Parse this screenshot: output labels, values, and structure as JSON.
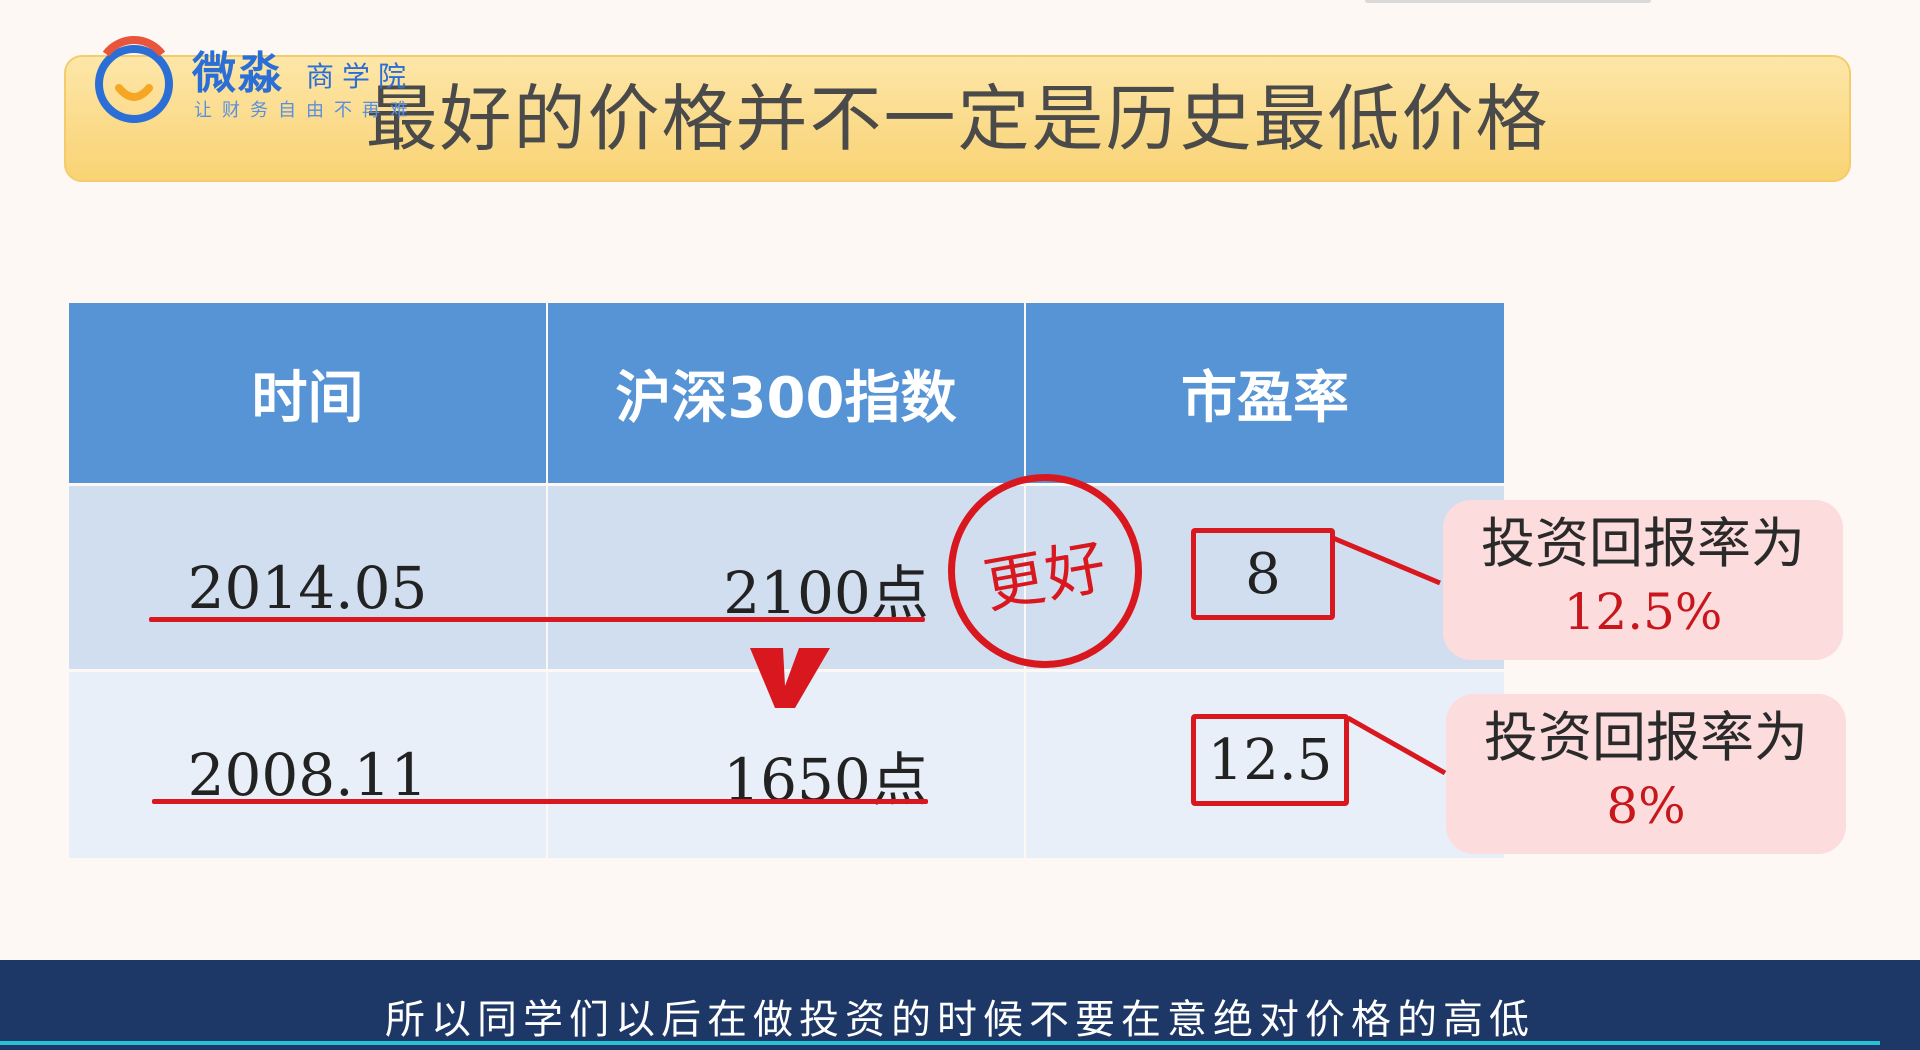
{
  "slide": {
    "title": "最好的价格并不一定是历史最低价格",
    "logo": {
      "name": "微淼",
      "sub": "商学院",
      "slogan": "让财务自由不再难"
    }
  },
  "table": {
    "headers": [
      "时间",
      "沪深300指数",
      "市盈率"
    ],
    "rows": [
      {
        "date": "2014.05",
        "index": "2100点",
        "pe": "8"
      },
      {
        "date": "2008.11",
        "index": "1650点",
        "pe": "12.5"
      }
    ]
  },
  "annotations": {
    "stamp": "更好",
    "callouts": [
      {
        "title": "投资回报率为",
        "value": "12.5%"
      },
      {
        "title": "投资回报率为",
        "value": "8%"
      }
    ],
    "compare_mark": "V"
  },
  "subtitle": "所以同学们以后在做投资的时候不要在意绝对价格的高低",
  "colors": {
    "header_blue": "#5694d6",
    "row1": "#d1def0",
    "row2": "#e9eff8",
    "annotation_red": "#d8181e",
    "subtitle_bar": "#1d3767"
  }
}
